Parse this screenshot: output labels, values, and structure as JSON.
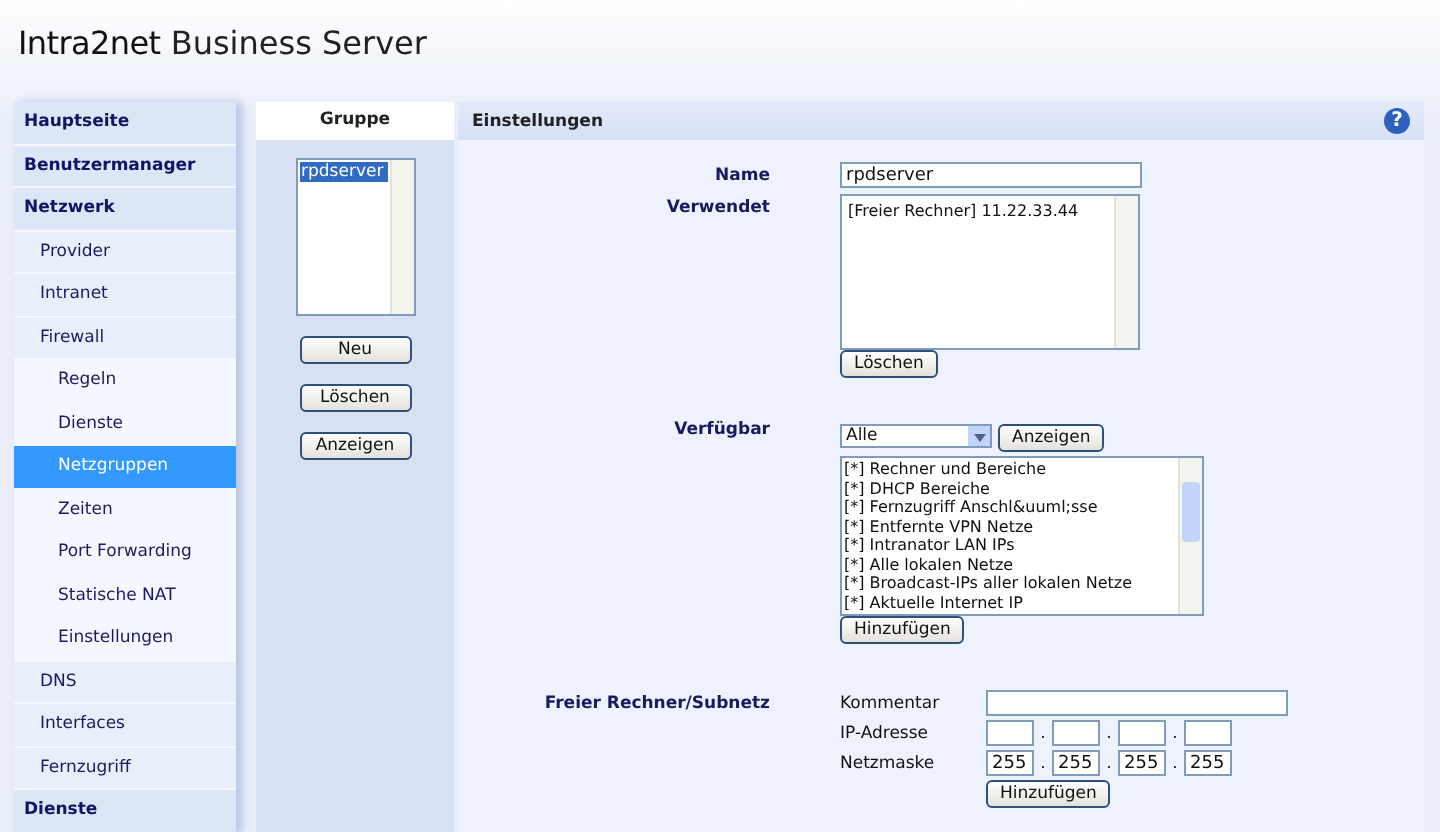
{
  "header": {
    "brand": "Intra2net",
    "product": "Business Server"
  },
  "sidebar": {
    "items": [
      {
        "label": "Hauptseite",
        "selected": false
      },
      {
        "label": "Benutzermanager",
        "selected": false
      },
      {
        "label": "Netzwerk",
        "selected": false,
        "children": [
          {
            "label": "Provider",
            "selected": false
          },
          {
            "label": "Intranet",
            "selected": false
          },
          {
            "label": "Firewall",
            "selected": false,
            "children": [
              {
                "label": "Regeln",
                "selected": false
              },
              {
                "label": "Dienste",
                "selected": false
              },
              {
                "label": "Netzgruppen",
                "selected": true
              },
              {
                "label": "Zeiten",
                "selected": false
              },
              {
                "label": "Port Forwarding",
                "selected": false
              },
              {
                "label": "Statische NAT",
                "selected": false
              },
              {
                "label": "Einstellungen",
                "selected": false
              }
            ]
          },
          {
            "label": "DNS",
            "selected": false
          },
          {
            "label": "Interfaces",
            "selected": false
          },
          {
            "label": "Fernzugriff",
            "selected": false
          }
        ]
      },
      {
        "label": "Dienste",
        "selected": false
      }
    ]
  },
  "group_panel": {
    "title": "Gruppe",
    "items": [
      {
        "label": "rpdserver",
        "selected": true
      }
    ],
    "buttons": [
      "Neu",
      "Löschen",
      "Anzeigen"
    ]
  },
  "settings": {
    "title": "Einstellungen",
    "help": "?",
    "name": {
      "label": "Name",
      "value": "rpdserver"
    },
    "used": {
      "label": "Verwendet",
      "items": [
        "[Freier Rechner] 11.22.33.44"
      ],
      "button": "Löschen"
    },
    "available": {
      "label": "Verfügbar",
      "filter": "Alle",
      "show_button": "Anzeigen",
      "items": [
        "[*] Rechner und Bereiche",
        "[*] DHCP Bereiche",
        "[*] Fernzugriff Anschl&uuml;sse",
        "[*] Entfernte VPN Netze",
        "[*] Intranator LAN IPs",
        "[*] Alle lokalen Netze",
        "[*] Broadcast-IPs aller lokalen Netze",
        "[*] Aktuelle Internet IP"
      ],
      "button": "Hinzufügen"
    },
    "free_host": {
      "label": "Freier Rechner/Subnetz",
      "comment_label": "Kommentar",
      "ip_label": "IP-Adresse",
      "mask_label": "Netzmaske",
      "mask": [
        "255",
        "255",
        "255",
        "255"
      ],
      "separator": ".",
      "button": "Hinzufügen"
    }
  }
}
